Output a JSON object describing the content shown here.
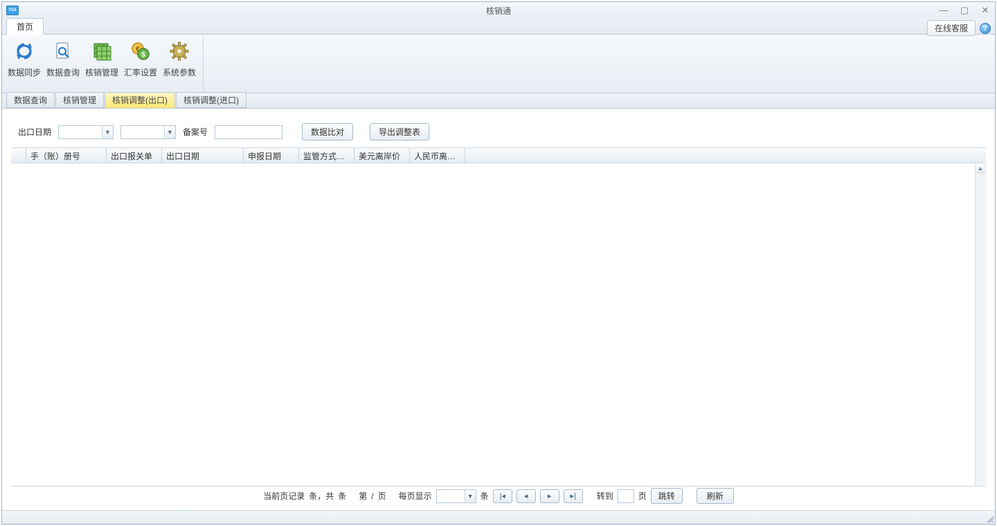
{
  "titlebar": {
    "title": "核销通",
    "app_icon_text": "TAX"
  },
  "toptabs": {
    "home": "首页",
    "online_service": "在线客服"
  },
  "ribbon": {
    "items": [
      {
        "label": "数据同步",
        "icon": "sync"
      },
      {
        "label": "数据查询",
        "icon": "search-doc"
      },
      {
        "label": "核销管理",
        "icon": "grid"
      },
      {
        "label": "汇率设置",
        "icon": "currency"
      },
      {
        "label": "系统参数",
        "icon": "gear"
      }
    ]
  },
  "innertabs": [
    {
      "label": "数据查询",
      "active": false
    },
    {
      "label": "核销管理",
      "active": false
    },
    {
      "label": "核销调整(出口)",
      "active": true
    },
    {
      "label": "核销调整(进口)",
      "active": false
    }
  ],
  "filter": {
    "date_label": "出口日期",
    "record_no_label": "备案号",
    "compare_btn": "数据比对",
    "export_btn": "导出调整表"
  },
  "columns": [
    "手（账）册号",
    "出口报关单",
    "出口日期",
    "申报日期",
    "监管方式…",
    "美元离岸价",
    "人民币离…"
  ],
  "pager": {
    "current_label_prefix": "当前页记录",
    "tiao": "条，共",
    "tiao2": "条",
    "di": "第",
    "slash": "/",
    "ye": "页",
    "per_page": "每页显示",
    "tiao3": "条",
    "goto": "转到",
    "ye2": "页",
    "jump": "跳转",
    "refresh": "刷新"
  }
}
